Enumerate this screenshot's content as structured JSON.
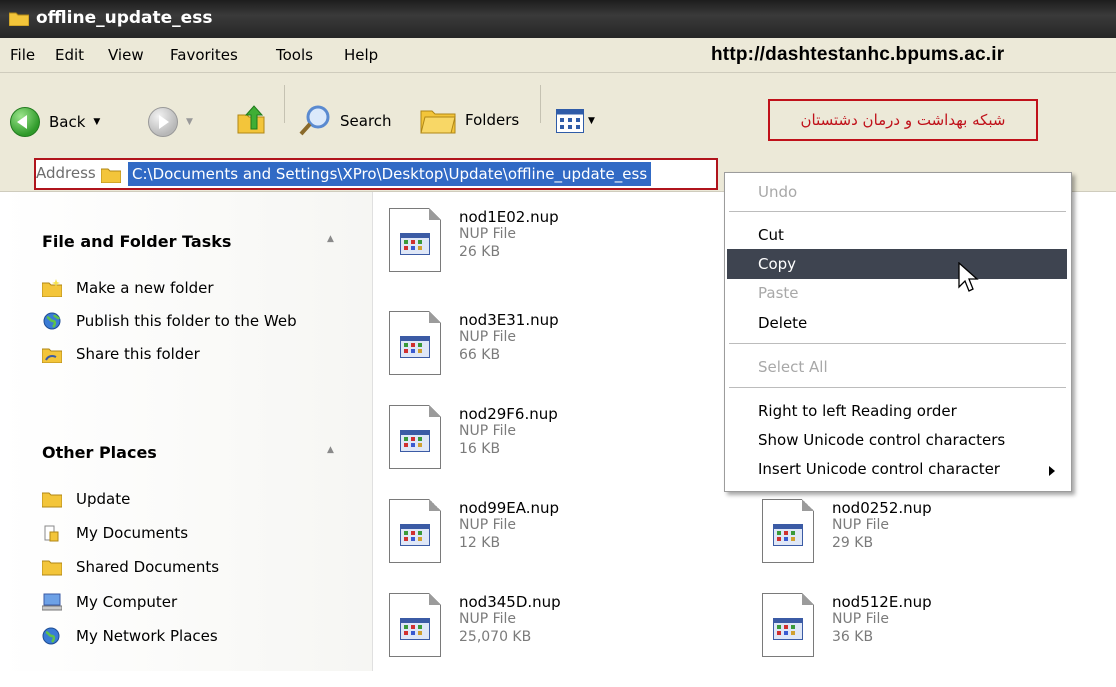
{
  "window": {
    "title": "offline_update_ess"
  },
  "menu": {
    "items": [
      "File",
      "Edit",
      "View",
      "Favorites",
      "Tools",
      "Help"
    ],
    "url_text": "http://dashtestanhc.bpums.ac.ir"
  },
  "toolbar": {
    "back_label": "Back",
    "search_label": "Search",
    "folders_label": "Folders",
    "persian_label": "شبکه بهداشت و درمان دشتستان"
  },
  "address": {
    "label": "Address",
    "value": "C:\\Documents and Settings\\XPro\\Desktop\\Update\\offline_update_ess"
  },
  "left_panel": {
    "file_tasks": {
      "title": "File and Folder Tasks",
      "items": [
        "Make a new folder",
        "Publish this folder to the Web",
        "Share this folder"
      ]
    },
    "other_places": {
      "title": "Other Places",
      "items": [
        "Update",
        "My Documents",
        "Shared Documents",
        "My Computer",
        "My Network Places"
      ]
    }
  },
  "files": [
    {
      "name": "nod1E02.nup",
      "type": "NUP File",
      "size": "26 KB"
    },
    {
      "name": "nod3E31.nup",
      "type": "NUP File",
      "size": "66 KB"
    },
    {
      "name": "nod29F6.nup",
      "type": "NUP File",
      "size": "16 KB"
    },
    {
      "name": "nod99EA.nup",
      "type": "NUP File",
      "size": "12 KB"
    },
    {
      "name": "nod345D.nup",
      "type": "NUP File",
      "size": "25,070 KB"
    },
    {
      "name": "nod0252.nup",
      "type": "NUP File",
      "size": "29 KB"
    },
    {
      "name": "nod512E.nup",
      "type": "NUP File",
      "size": "36 KB"
    }
  ],
  "context_menu": {
    "items": [
      "Undo",
      "Cut",
      "Copy",
      "Paste",
      "Delete",
      "Select All",
      "Right to left Reading order",
      "Show Unicode control characters",
      "Insert Unicode control character"
    ],
    "disabled": [
      "Undo",
      "Paste",
      "Select All"
    ],
    "highlighted": "Copy"
  },
  "colors": {
    "title_bar": "#262626",
    "chrome": "#ece9d8",
    "selection": "#316ac5",
    "menu_highlight": "#3e4450",
    "annotation_red": "#c0111a"
  }
}
